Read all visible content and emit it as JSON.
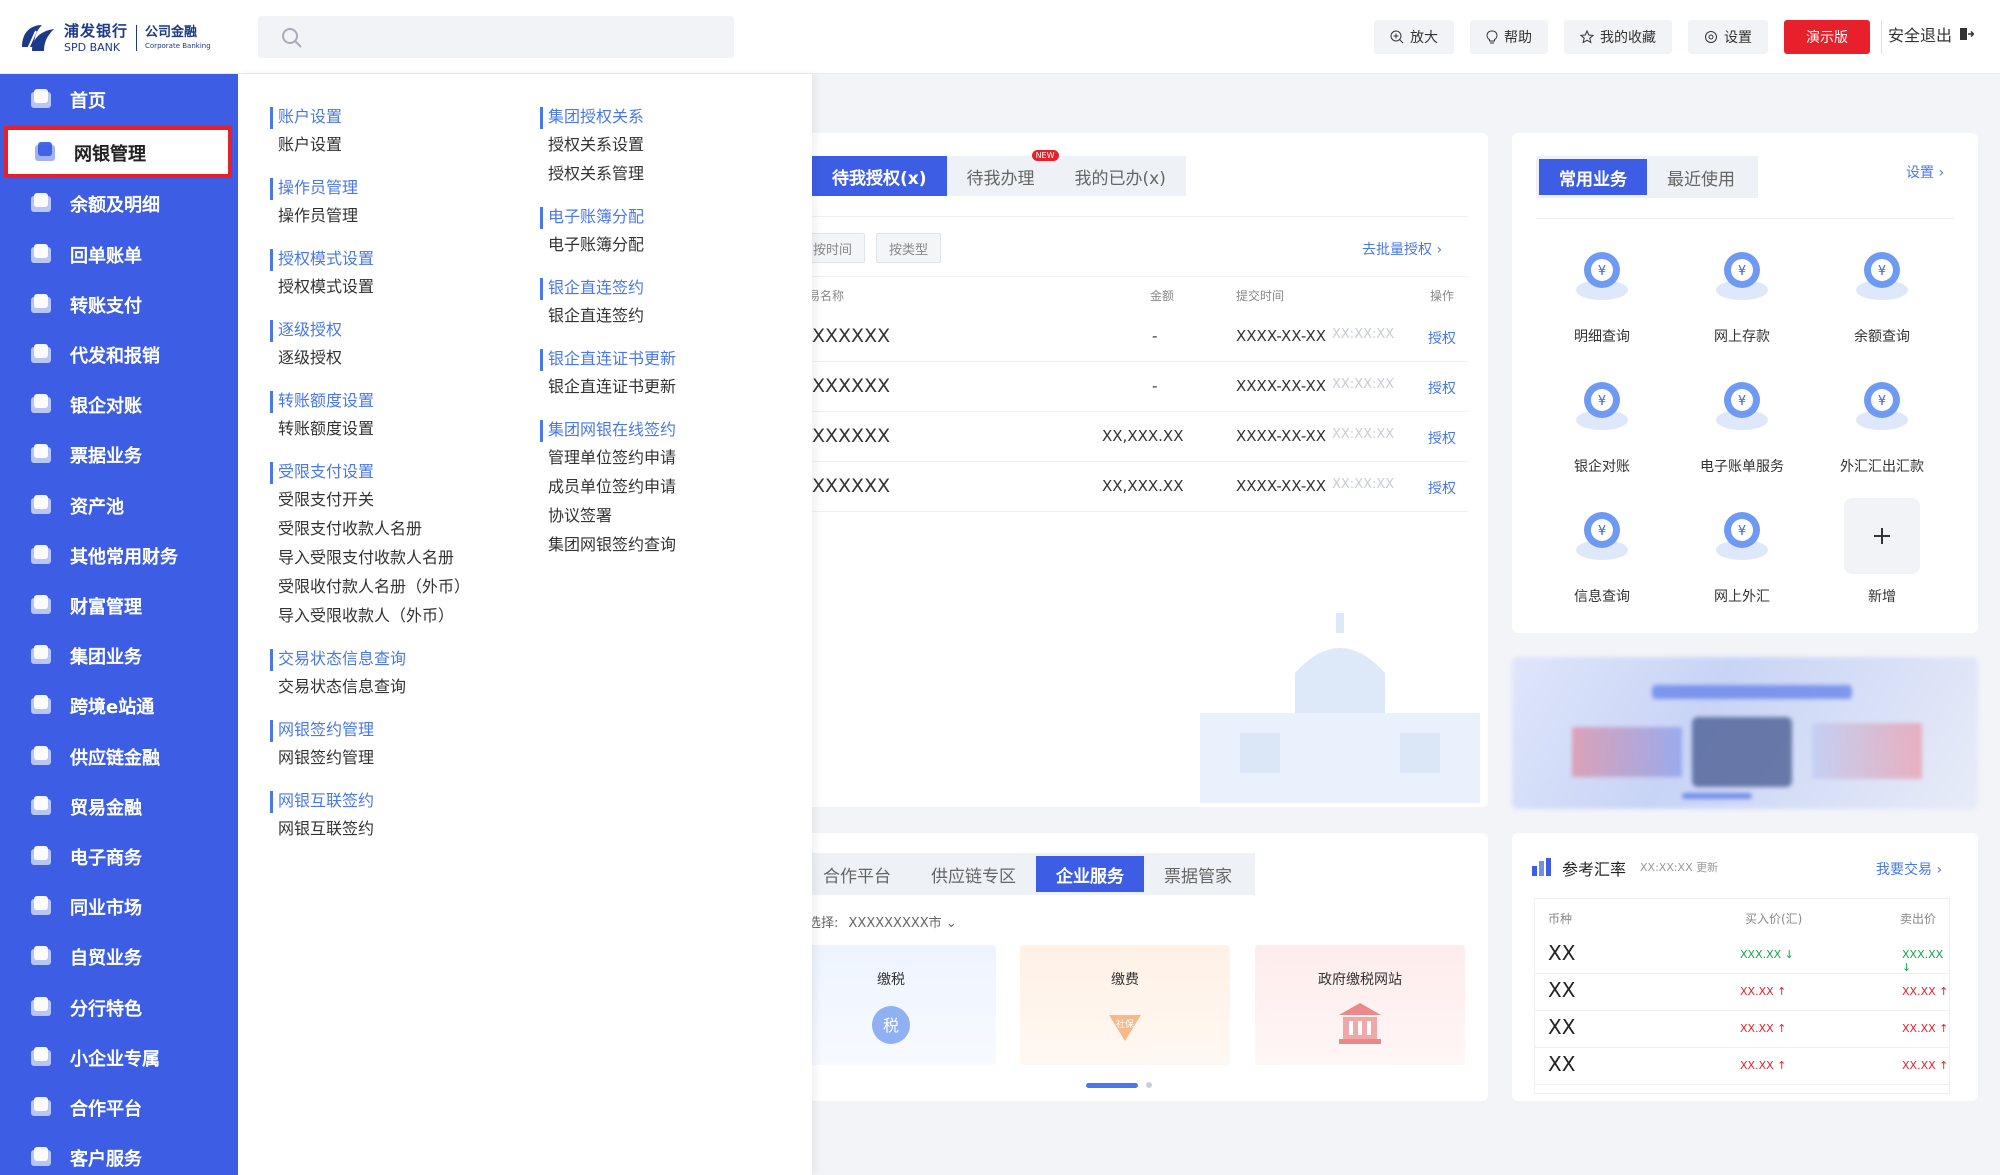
{
  "header": {
    "logo_cn": "浦发银行",
    "logo_en": "SPD BANK",
    "logo_sub_cn": "公司金融",
    "logo_sub_en": "Corporate Banking",
    "search_placeholder": "",
    "buttons": [
      {
        "label": "放大",
        "icon": "zoom-in-icon"
      },
      {
        "label": "帮助",
        "icon": "lightbulb-icon"
      },
      {
        "label": "我的收藏",
        "icon": "star-icon"
      },
      {
        "label": "设置",
        "icon": "gear-icon"
      },
      {
        "label": "演示版",
        "icon": ""
      }
    ],
    "logout": "安全退出"
  },
  "sidebar": {
    "items": [
      {
        "label": "首页",
        "icon": "home-icon"
      },
      {
        "label": "网银管理",
        "icon": "card-icon",
        "active": true
      },
      {
        "label": "余额及明细",
        "icon": "wallet-icon"
      },
      {
        "label": "回单账单",
        "icon": "receipt-icon"
      },
      {
        "label": "转账支付",
        "icon": "transfer-icon"
      },
      {
        "label": "代发和报销",
        "icon": "payroll-icon"
      },
      {
        "label": "银企对账",
        "icon": "reconcile-icon"
      },
      {
        "label": "票据业务",
        "icon": "bill-icon"
      },
      {
        "label": "资产池",
        "icon": "asset-pool-icon"
      },
      {
        "label": "其他常用财务",
        "icon": "finance-icon"
      },
      {
        "label": "财富管理",
        "icon": "wealth-icon"
      },
      {
        "label": "集团业务",
        "icon": "group-icon"
      },
      {
        "label": "跨境e站通",
        "icon": "globe-icon"
      },
      {
        "label": "供应链金融",
        "icon": "chain-icon"
      },
      {
        "label": "贸易金融",
        "icon": "trade-icon"
      },
      {
        "label": "电子商务",
        "icon": "cart-icon"
      },
      {
        "label": "同业市场",
        "icon": "market-icon"
      },
      {
        "label": "自贸业务",
        "icon": "ftz-icon"
      },
      {
        "label": "分行特色",
        "icon": "branch-icon"
      },
      {
        "label": "小企业专属",
        "icon": "sme-icon"
      },
      {
        "label": "合作平台",
        "icon": "partner-icon"
      },
      {
        "label": "客户服务",
        "icon": "service-icon"
      }
    ]
  },
  "mega_menu": {
    "col1": [
      {
        "head": "账户设置",
        "links": [
          "账户设置"
        ]
      },
      {
        "head": "操作员管理",
        "links": [
          "操作员管理"
        ]
      },
      {
        "head": "授权模式设置",
        "links": [
          "授权模式设置"
        ]
      },
      {
        "head": "逐级授权",
        "links": [
          "逐级授权"
        ]
      },
      {
        "head": "转账额度设置",
        "links": [
          "转账额度设置"
        ]
      },
      {
        "head": "受限支付设置",
        "links": [
          "受限支付开关",
          "受限支付收款人名册",
          "导入受限支付收款人名册",
          "受限收付款人名册（外币）",
          "导入受限收款人（外币）"
        ]
      },
      {
        "head": "交易状态信息查询",
        "links": [
          "交易状态信息查询"
        ]
      },
      {
        "head": "网银签约管理",
        "links": [
          "网银签约管理"
        ]
      },
      {
        "head": "网银互联签约",
        "links": [
          "网银互联签约"
        ]
      }
    ],
    "col2": [
      {
        "head": "集团授权关系",
        "links": [
          "授权关系设置",
          "授权关系管理"
        ]
      },
      {
        "head": "电子账簿分配",
        "links": [
          "电子账簿分配"
        ]
      },
      {
        "head": "银企直连签约",
        "links": [
          "银企直连签约"
        ]
      },
      {
        "head": "银企直连证书更新",
        "links": [
          "银企直连证书更新"
        ]
      },
      {
        "head": "集团网银在线签约",
        "links": [
          "管理单位签约申请",
          "成员单位签约申请",
          "协议签署",
          "集团网银签约查询"
        ]
      }
    ]
  },
  "tasks": {
    "tabs": [
      "待我授权(x)",
      "待我办理",
      "我的已办(x)"
    ],
    "new_badge": "NEW",
    "filters": [
      "按时间",
      "按类型"
    ],
    "batch_link": "去批量授权",
    "columns": [
      "易名称",
      "金额",
      "提交时间",
      "操作"
    ],
    "rows": [
      {
        "name": "XXXXXX",
        "amount": "-",
        "date": "XXXX-XX-XX",
        "time": "XX:XX:XX",
        "action": "授权"
      },
      {
        "name": "XXXXXX",
        "amount": "-",
        "date": "XXXX-XX-XX",
        "time": "XX:XX:XX",
        "action": "授权"
      },
      {
        "name": "XXXXXX",
        "amount": "XX,XXX.XX",
        "date": "XXXX-XX-XX",
        "time": "XX:XX:XX",
        "action": "授权"
      },
      {
        "name": "XXXXXX",
        "amount": "XX,XXX.XX",
        "date": "XXXX-XX-XX",
        "time": "XX:XX:XX",
        "action": "授权"
      }
    ]
  },
  "common": {
    "tabs": [
      "常用业务",
      "最近使用"
    ],
    "settings_link": "设置",
    "items": [
      {
        "label": "明细查询",
        "icon": "search-coin-icon"
      },
      {
        "label": "网上存款",
        "icon": "deposit-icon"
      },
      {
        "label": "余额查询",
        "icon": "balance-icon"
      },
      {
        "label": "银企对账",
        "icon": "reconcile-coin-icon"
      },
      {
        "label": "电子账单服务",
        "icon": "ebill-icon"
      },
      {
        "label": "外汇汇出汇款",
        "icon": "fx-remit-icon"
      },
      {
        "label": "信息查询",
        "icon": "info-query-icon"
      },
      {
        "label": "网上外汇",
        "icon": "fx-online-icon"
      },
      {
        "label": "新增",
        "icon": "plus-icon"
      }
    ]
  },
  "services": {
    "tabs": [
      "合作平台",
      "供应链专区",
      "企业服务",
      "票据管家"
    ],
    "select_label": "选择:",
    "select_value": "XXXXXXXXX市",
    "cards": [
      {
        "label": "缴税",
        "icon": "tax-icon"
      },
      {
        "label": "缴费",
        "icon": "social-fee-icon"
      },
      {
        "label": "政府缴税网站",
        "icon": "gov-building-icon"
      }
    ]
  },
  "rates": {
    "title": "参考汇率",
    "updated": "XX:XX:XX 更新",
    "trade_link": "我要交易",
    "columns": [
      "币种",
      "买入价(汇)",
      "卖出价"
    ],
    "rows": [
      {
        "currency": "XX",
        "buy": "XXX.XX",
        "sell": "XXX.XX",
        "dir": "down"
      },
      {
        "currency": "XX",
        "buy": "XX.XX",
        "sell": "XX.XX",
        "dir": "up"
      },
      {
        "currency": "XX",
        "buy": "XX.XX",
        "sell": "XX.XX",
        "dir": "up"
      },
      {
        "currency": "XX",
        "buy": "XX.XX",
        "sell": "XX.XX",
        "dir": "up"
      }
    ]
  },
  "colors": {
    "brand": "#3d5ee4",
    "danger": "#e8202c",
    "link": "#4a78e6",
    "up": "#e8202c",
    "down": "#1aa34a"
  }
}
